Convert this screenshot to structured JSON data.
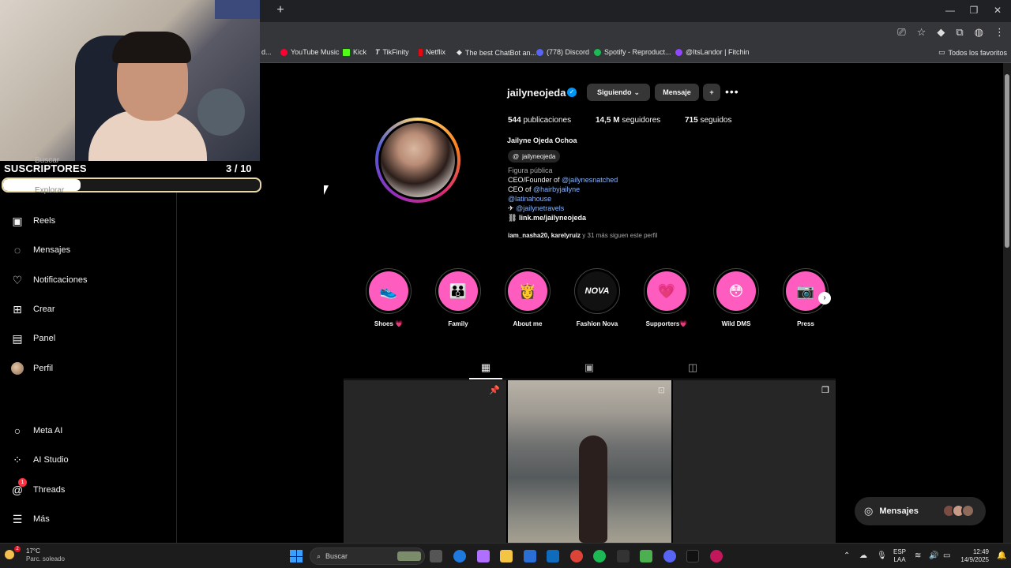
{
  "bookmarks": [
    {
      "label": "d...",
      "color": "#888888"
    },
    {
      "label": "YouTube Music",
      "color": "#ff0033"
    },
    {
      "label": "Kick",
      "color": "#53fc18"
    },
    {
      "label": "TikFinity",
      "color": "#ffffff"
    },
    {
      "label": "Netflix",
      "color": "#e50914"
    },
    {
      "label": "The best ChatBot an...",
      "color": "#ffffff"
    },
    {
      "label": "(778) Discord",
      "color": "#5865f2"
    },
    {
      "label": "Spotify - Reproduct...",
      "color": "#1db954"
    },
    {
      "label": "@ItsLandor | Fitchin",
      "color": "#9146ff"
    }
  ],
  "bookmarks_all": "Todos los favoritos",
  "overlay": {
    "subs_label": "SUSCRIPTORES",
    "subs_count": "3 / 10",
    "subs_progress": 0.3,
    "ghost_search": "Buscar",
    "ghost_explore": "Explorar"
  },
  "sidebar": {
    "items": [
      {
        "label": "Reels",
        "icon": "reels-icon"
      },
      {
        "label": "Mensajes",
        "icon": "messenger-icon"
      },
      {
        "label": "Notificaciones",
        "icon": "heart-icon"
      },
      {
        "label": "Crear",
        "icon": "plus-square-icon"
      },
      {
        "label": "Panel",
        "icon": "dashboard-icon"
      },
      {
        "label": "Perfil",
        "icon": "avatar-icon"
      }
    ],
    "bottom_items": [
      {
        "label": "Meta AI",
        "icon": "meta-ai-icon"
      },
      {
        "label": "AI Studio",
        "icon": "ai-studio-icon"
      },
      {
        "label": "Threads",
        "icon": "threads-icon",
        "badge": "1"
      },
      {
        "label": "Más",
        "icon": "menu-icon"
      }
    ]
  },
  "profile": {
    "username": "jailyneojeda",
    "follow_button": "Siguiendo",
    "message_button": "Mensaje",
    "posts_count": "544",
    "posts_label": "publicaciones",
    "followers_count": "14,5 M",
    "followers_label": "seguidores",
    "following_count": "715",
    "following_label": "seguidos",
    "full_name": "Jailyne Ojeda Ochoa",
    "threads_handle": "jailyneojeda",
    "category": "Figura pública",
    "bio_line1_prefix": "CEO/Founder of ",
    "bio_line1_link": "@jailynesnatched",
    "bio_line2_prefix": "CEO of ",
    "bio_line2_link": "@hairbyjailyne",
    "bio_line3_link": "@latinahouse",
    "bio_line4_link": "@jailynetravels",
    "external_link": "link.me/jailyneojeda",
    "followed_by_names": "iam_nasha20, karelyruiz",
    "followed_by_rest": " y 31 más siguen este perfil"
  },
  "highlights": [
    {
      "label": "Shoes 💗",
      "glyph": "👟"
    },
    {
      "label": "Family",
      "glyph": "👪"
    },
    {
      "label": "About me",
      "glyph": "👸"
    },
    {
      "label": "Fashion Nova",
      "glyph": "NOVA"
    },
    {
      "label": "Supporters💗",
      "glyph": "💗"
    },
    {
      "label": "Wild DMS",
      "glyph": "😳"
    },
    {
      "label": "Press",
      "glyph": "📷"
    }
  ],
  "messages_pill": {
    "label": "Mensajes"
  },
  "taskbar": {
    "temp": "17°C",
    "weather": "Parc. soleado",
    "weather_badge": "2",
    "search": "Buscar",
    "lang1": "ESP",
    "lang2": "LAA",
    "time": "12:49",
    "date": "14/9/2025"
  },
  "colors": {
    "highlight_pink": "#ff5cc0",
    "verified_blue": "#0095f6",
    "link_blue": "#8ab4f8"
  }
}
